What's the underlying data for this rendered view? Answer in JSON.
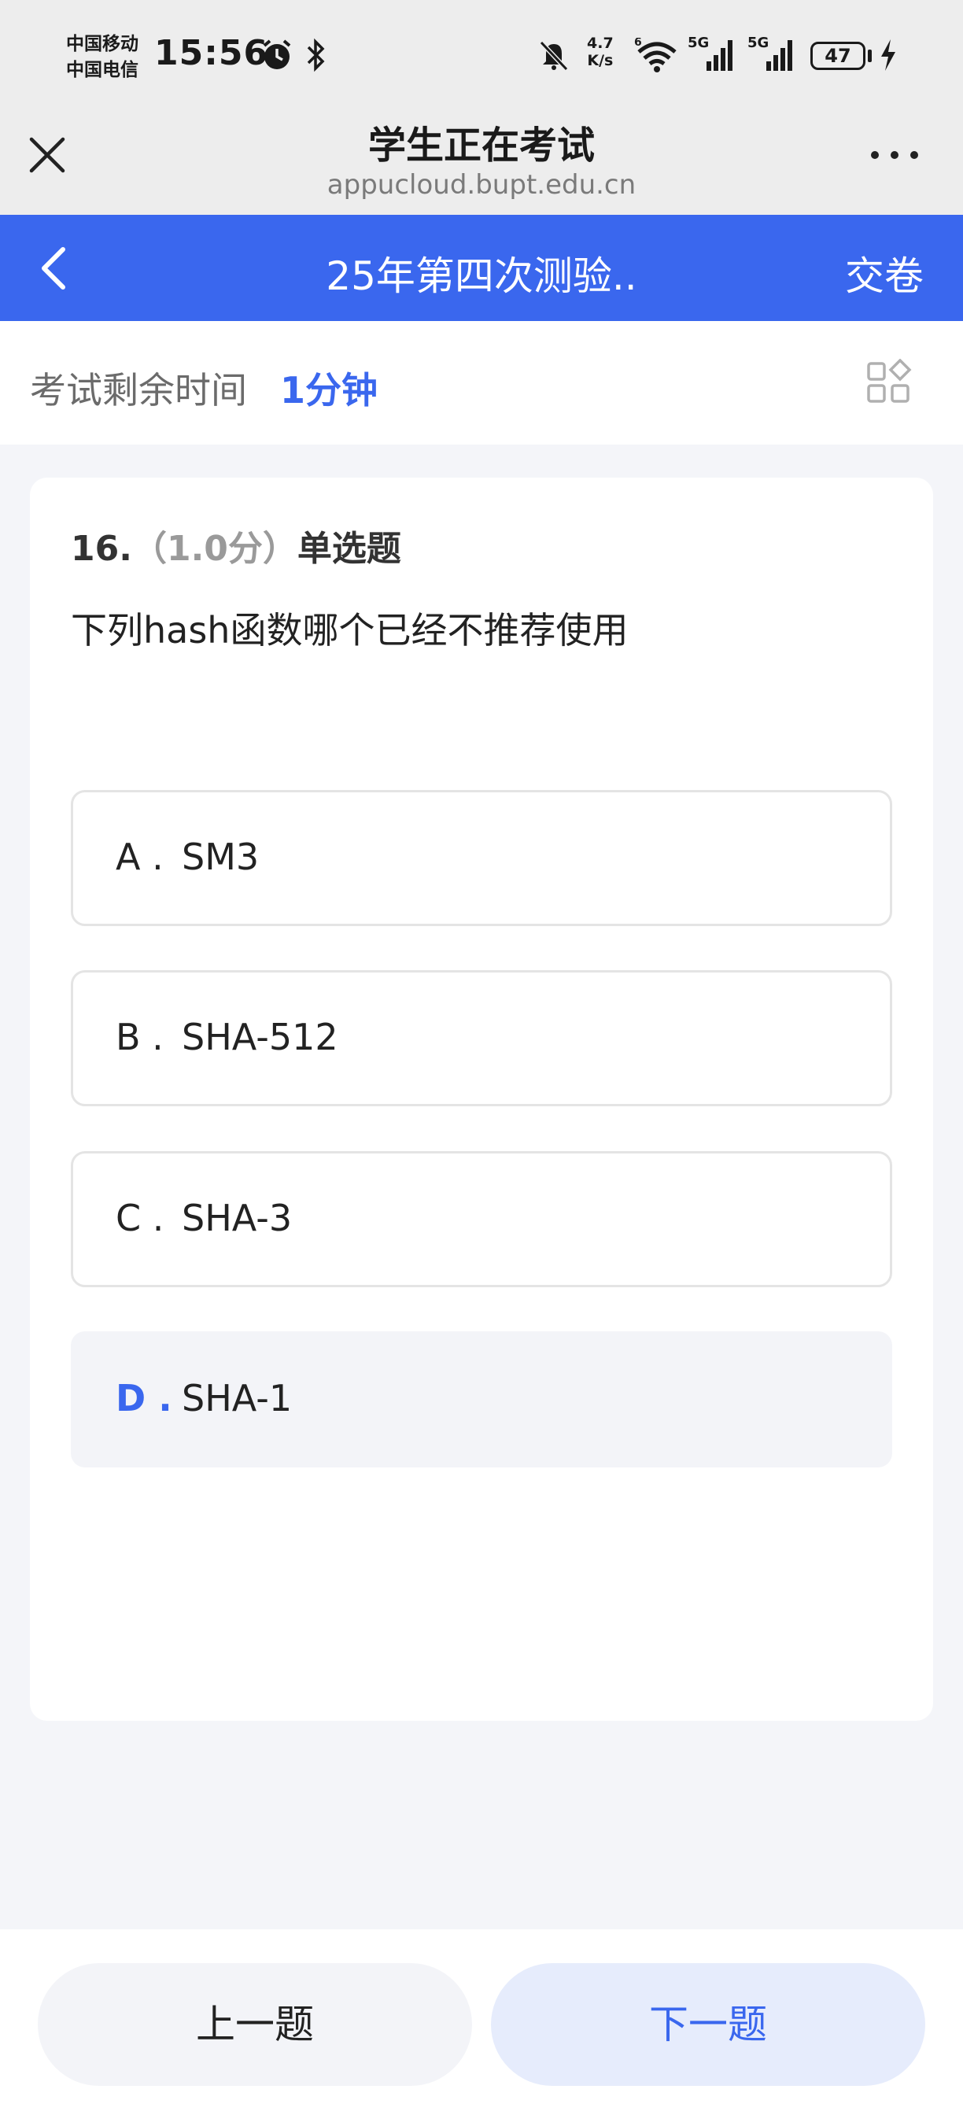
{
  "status_bar": {
    "carrier_1": "中国移动",
    "carrier_2": "中国电信",
    "time": "15:56",
    "net_speed_value": "4.7",
    "net_speed_unit": "K/s",
    "signal_1": "5G",
    "signal_2": "5G",
    "wifi_badge": "6",
    "battery": "47",
    "icons": [
      "alarm-icon",
      "bluetooth-icon",
      "mute-icon",
      "wifi-icon",
      "signal-icon",
      "signal-icon",
      "battery-icon",
      "charging-icon"
    ]
  },
  "browser": {
    "title": "学生正在考试",
    "url": "appucloud.bupt.edu.cn",
    "close_icon": "close-icon",
    "more_icon": "more-icon"
  },
  "app_bar": {
    "title": "25年第四次测验..",
    "submit_label": "交卷",
    "back_icon": "chevron-left-icon",
    "bg_color": "#3a67ee"
  },
  "timer": {
    "label": "考试剩余时间",
    "value": "1分钟",
    "grid_icon": "question-grid-icon"
  },
  "question": {
    "number": "16.",
    "score": "（1.0分）",
    "type": "单选题",
    "text": "下列hash函数哪个已经不推荐使用",
    "options": [
      {
        "letter": "A .",
        "text": "SM3",
        "selected": false
      },
      {
        "letter": "B .",
        "text": "SHA-512",
        "selected": false
      },
      {
        "letter": "C .",
        "text": "SHA-3",
        "selected": false
      },
      {
        "letter": "D .",
        "text": "SHA-1",
        "selected": true
      }
    ]
  },
  "nav": {
    "prev_label": "上一题",
    "next_label": "下一题"
  }
}
